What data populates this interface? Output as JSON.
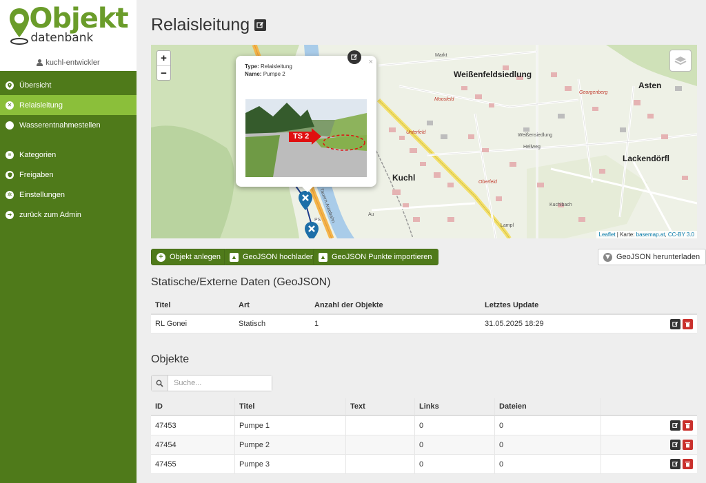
{
  "app": {
    "logo_title": "Objekt",
    "logo_subtitle": "datenbank",
    "user": "kuchl-entwickler"
  },
  "sidebar": {
    "items": [
      {
        "label": "Übersicht",
        "icon": "map-pin-icon"
      },
      {
        "label": "Relaisleitung",
        "icon": "close-circle-icon",
        "active": true
      },
      {
        "label": "Wasserentnahmestellen",
        "icon": "circle-icon"
      },
      {
        "label": "Kategorien",
        "icon": "list-icon"
      },
      {
        "label": "Freigaben",
        "icon": "shield-icon"
      },
      {
        "label": "Einstellungen",
        "icon": "gear-icon"
      },
      {
        "label": "zurück zum Admin",
        "icon": "sign-out-icon"
      }
    ]
  },
  "page": {
    "title": "Relaisleitung"
  },
  "map": {
    "zoom_in": "+",
    "zoom_out": "−",
    "popup": {
      "type_label": "Type:",
      "type_value": "Relaisleitung",
      "name_label": "Name:",
      "name_value": "Pumpe 2",
      "close": "×",
      "photo_label": "TS 2"
    },
    "attribution": {
      "leaflet": "Leaflet",
      "sep": " | Karte: ",
      "basemap": "basemap.at",
      "comma": ", ",
      "license": "CC-BY 3.0"
    },
    "places": {
      "weissenfeldsiedlung": "Weißenfeldsiedlung",
      "asten": "Asten",
      "kuchl": "Kuchl",
      "lackendoerfl": "Lackendörfl",
      "weissensiedlung": "Weißensiedlung",
      "hellweg": "Hellweg",
      "kuchlbach": "Kuchlbach",
      "lampl": "Lampl",
      "georgenberg": "Georgenberg",
      "moosfeld": "Moosfeld",
      "unterfeld": "Unterfeld",
      "oberfeld": "Oberfeld",
      "markt": "Markt",
      "autobahn": "Tauern Autobahn",
      "ps": "PS",
      "au": "Au"
    }
  },
  "actions": {
    "create": "Objekt anlegen",
    "upload": "GeoJSON hochladen",
    "import_points": "GeoJSON Punkte importieren",
    "download": "GeoJSON herunterladen"
  },
  "static_section": {
    "title": "Statische/Externe Daten (GeoJSON)",
    "columns": [
      "Titel",
      "Art",
      "Anzahl der Objekte",
      "Letztes Update"
    ],
    "rows": [
      {
        "titel": "RL Gonei",
        "art": "Statisch",
        "anzahl": "1",
        "update": "31.05.2025 18:29"
      }
    ]
  },
  "objects_section": {
    "title": "Objekte",
    "search_placeholder": "Suche...",
    "columns": [
      "ID",
      "Titel",
      "Text",
      "Links",
      "Dateien"
    ],
    "rows": [
      {
        "id": "47453",
        "titel": "Pumpe 1",
        "text": "",
        "links": "0",
        "dateien": "0"
      },
      {
        "id": "47454",
        "titel": "Pumpe 2",
        "text": "",
        "links": "0",
        "dateien": "0"
      },
      {
        "id": "47455",
        "titel": "Pumpe 3",
        "text": "",
        "links": "0",
        "dateien": "0"
      }
    ]
  },
  "colors": {
    "sidebar": "#4f7a1a",
    "sidebar_active": "#8bbf3a",
    "danger": "#c9302c",
    "marker": "#1d6fa8"
  }
}
